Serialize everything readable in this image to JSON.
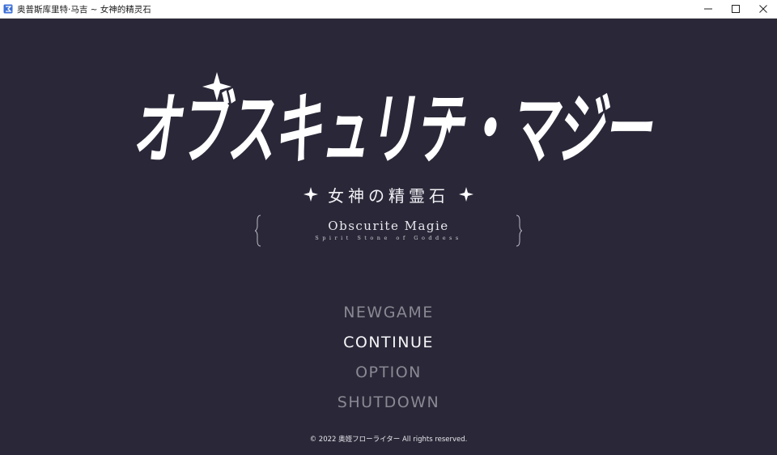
{
  "window": {
    "title": "奥普斯库里特·马吉 ~ 女神的精灵石",
    "icon": "app-icon",
    "controls": [
      "minimize-icon",
      "maximize-icon",
      "close-icon"
    ]
  },
  "game": {
    "background_color": "#2a2838",
    "logo": {
      "main_text": "オブスキュリテ・マジー",
      "subtitle_jp": "女神の精霊石",
      "emblem_title": "Obscurite Magie",
      "emblem_subtitle": "Spirit Stone of Goddess"
    },
    "menu": {
      "items": [
        {
          "label": "NEWGAME",
          "selected": false
        },
        {
          "label": "CONTINUE",
          "selected": true
        },
        {
          "label": "OPTION",
          "selected": false
        },
        {
          "label": "SHUTDOWN",
          "selected": false
        }
      ]
    },
    "copyright": "© 2022 奥姪フローライター All rights reserved."
  }
}
